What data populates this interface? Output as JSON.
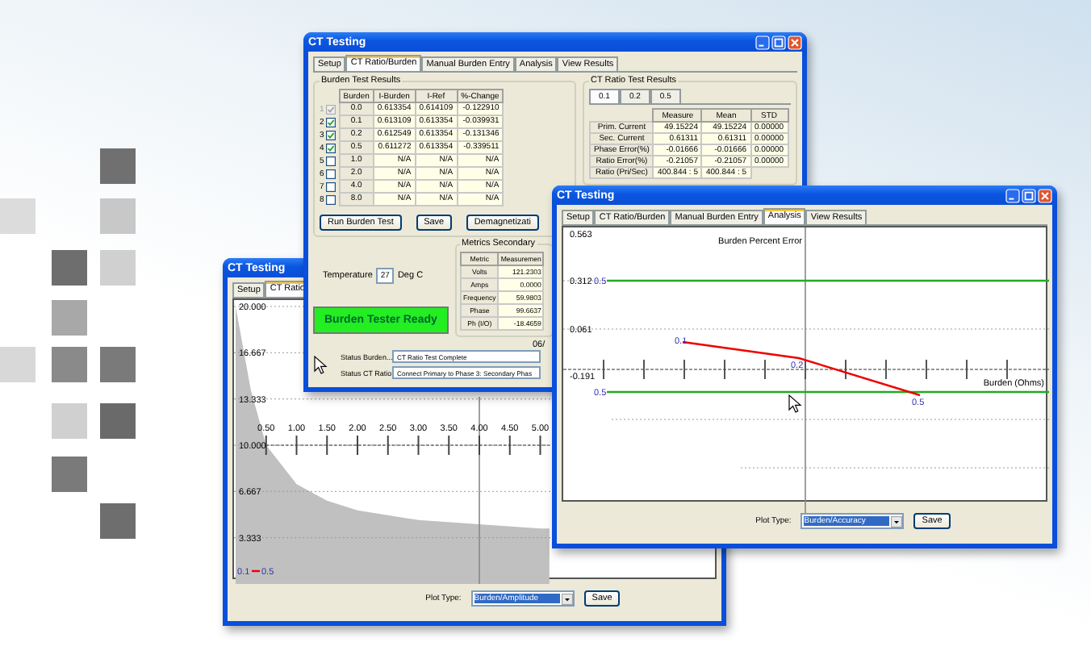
{
  "ratio_window": {
    "title": "CT Testing",
    "tabs": [
      {
        "label": "Setup",
        "selected": false
      },
      {
        "label": "CT Ratio/Burden",
        "selected": true
      },
      {
        "label": "Manual Burden Entry",
        "selected": false
      },
      {
        "label": "Analysis",
        "selected": false
      },
      {
        "label": "View Results",
        "selected": false
      }
    ],
    "burden_results": {
      "title": "Burden Test Results",
      "columns": [
        "Burden",
        "I-Burden",
        "I-Ref",
        "%-Change"
      ],
      "rows": [
        {
          "index": "1",
          "checked": true,
          "disabled": true,
          "cells": [
            "0.0",
            "0.613354",
            "0.614109",
            "-0.122910"
          ]
        },
        {
          "index": "2",
          "checked": true,
          "disabled": false,
          "cells": [
            "0.1",
            "0.613109",
            "0.613354",
            "-0.039931"
          ]
        },
        {
          "index": "3",
          "checked": true,
          "disabled": false,
          "cells": [
            "0.2",
            "0.612549",
            "0.613354",
            "-0.131346"
          ]
        },
        {
          "index": "4",
          "checked": true,
          "disabled": false,
          "cells": [
            "0.5",
            "0.611272",
            "0.613354",
            "-0.339511"
          ]
        },
        {
          "index": "5",
          "checked": false,
          "disabled": false,
          "cells": [
            "1.0",
            "N/A",
            "N/A",
            "N/A"
          ]
        },
        {
          "index": "6",
          "checked": false,
          "disabled": false,
          "cells": [
            "2.0",
            "N/A",
            "N/A",
            "N/A"
          ]
        },
        {
          "index": "7",
          "checked": false,
          "disabled": false,
          "cells": [
            "4.0",
            "N/A",
            "N/A",
            "N/A"
          ]
        },
        {
          "index": "8",
          "checked": false,
          "disabled": false,
          "cells": [
            "8.0",
            "N/A",
            "N/A",
            "N/A"
          ]
        }
      ],
      "buttons": [
        "Run Burden Test",
        "Save",
        "Demagnetizati"
      ]
    },
    "ct_ratio_results": {
      "title": "CT Ratio Test Results",
      "tabs": [
        {
          "label": "0.1",
          "selected": true
        },
        {
          "label": "0.2",
          "selected": false
        },
        {
          "label": "0.5",
          "selected": false
        }
      ],
      "columns": [
        "Measure",
        "Mean",
        "STD"
      ],
      "rows": [
        {
          "label": "Prim. Current",
          "cells": [
            "49.15224",
            "49.15224",
            "0.00000"
          ]
        },
        {
          "label": "Sec. Current",
          "cells": [
            "0.61311",
            "0.61311",
            "0.00000"
          ]
        },
        {
          "label": "Phase Error(%)",
          "cells": [
            "-0.01666",
            "-0.01666",
            "0.00000"
          ]
        },
        {
          "label": "Ratio Error(%)",
          "cells": [
            "-0.21057",
            "-0.21057",
            "0.00000"
          ]
        },
        {
          "label": "Ratio (Pri/Sec)",
          "cells": [
            "400.844 : 5",
            "400.844 : 5"
          ]
        }
      ]
    },
    "temperature": {
      "label": "Temperature",
      "value": "27",
      "unit": "Deg C"
    },
    "status_indicator": "Burden Tester Ready",
    "metrics": {
      "title": "Metrics Secondary",
      "columns": [
        "Metric",
        "Measuremen"
      ],
      "rows": [
        [
          "Volts",
          "121.2303"
        ],
        [
          "Amps",
          "0.0000"
        ],
        [
          "Frequency",
          "59.9803"
        ],
        [
          "Phase",
          "99.6637"
        ],
        [
          "Ph (I/O)",
          "-18.4659"
        ]
      ]
    },
    "date": "06/",
    "status_fields": [
      {
        "label": "Status Burden...",
        "value": "CT Ratio Test Complete"
      },
      {
        "label": "Status CT Ratio:",
        "value": "Connect Primary to Phase 3: Secondary Phas"
      }
    ]
  },
  "amplitude_window": {
    "title": "CT Testing",
    "tabs": [
      {
        "label": "Setup",
        "selected": false
      },
      {
        "label": "CT Ratio",
        "selected": true
      }
    ],
    "chart_data": {
      "type": "area",
      "xlim": [
        0,
        8
      ],
      "ylim": [
        0,
        20
      ],
      "grid": true,
      "x": [
        0,
        0.25,
        0.5,
        1,
        1.5,
        2,
        3,
        4,
        5,
        5.15
      ],
      "series": [
        {
          "color": "#c0c0c0",
          "values": [
            20,
            14,
            10,
            7.2,
            6,
            5.3,
            4.6,
            4.3,
            4.0,
            4.0
          ]
        }
      ],
      "xticks": [
        {
          "value": 0.5,
          "label": "0.50"
        },
        {
          "value": 1,
          "label": "1.00"
        },
        {
          "value": 1.5,
          "label": "1.50"
        },
        {
          "value": 2,
          "label": "2.00"
        },
        {
          "value": 2.5,
          "label": "2.50"
        },
        {
          "value": 3,
          "label": "3.00"
        },
        {
          "value": 3.5,
          "label": "3.50"
        },
        {
          "value": 4,
          "label": "4.00"
        },
        {
          "value": 4.5,
          "label": "4.50"
        },
        {
          "value": 5,
          "label": "5.00"
        }
      ],
      "yticks": [
        {
          "value": 20,
          "label": "20.000"
        },
        {
          "value": 16.667,
          "label": "16.667"
        },
        {
          "value": 13.333,
          "label": "13.333"
        },
        {
          "value": 10,
          "label": "10.000"
        },
        {
          "value": 6.667,
          "label": "6.667"
        },
        {
          "value": 3.333,
          "label": "3.333"
        }
      ],
      "ref_lines": [
        {
          "axis": "y",
          "value": 10
        },
        {
          "axis": "x",
          "value": 4
        }
      ]
    },
    "legend": [
      "0.1",
      "0.5"
    ],
    "plot_type": {
      "label": "Plot Type:",
      "value": "Burden/Amplitude"
    },
    "save": "Save"
  },
  "accuracy_window": {
    "title": "CT Testing",
    "tabs": [
      {
        "label": "Setup",
        "selected": false
      },
      {
        "label": "CT Ratio/Burden",
        "selected": false
      },
      {
        "label": "Manual Burden Entry",
        "selected": false
      },
      {
        "label": "Analysis",
        "selected": true
      },
      {
        "label": "View Results",
        "selected": false
      }
    ],
    "chart": {
      "title": "Burden Percent Error",
      "y_labels": [
        "0.563",
        "0.312",
        "0.061",
        "-0.191"
      ],
      "x_label": "Burden (Ohms)",
      "point_labels": [
        "0.1",
        "0.2",
        "0.5"
      ],
      "upper_line_label": "0.5",
      "lower_line_label": "0.5"
    },
    "plot_type": {
      "label": "Plot Type:",
      "value": "Burden/Accuracy"
    },
    "save": "Save"
  }
}
